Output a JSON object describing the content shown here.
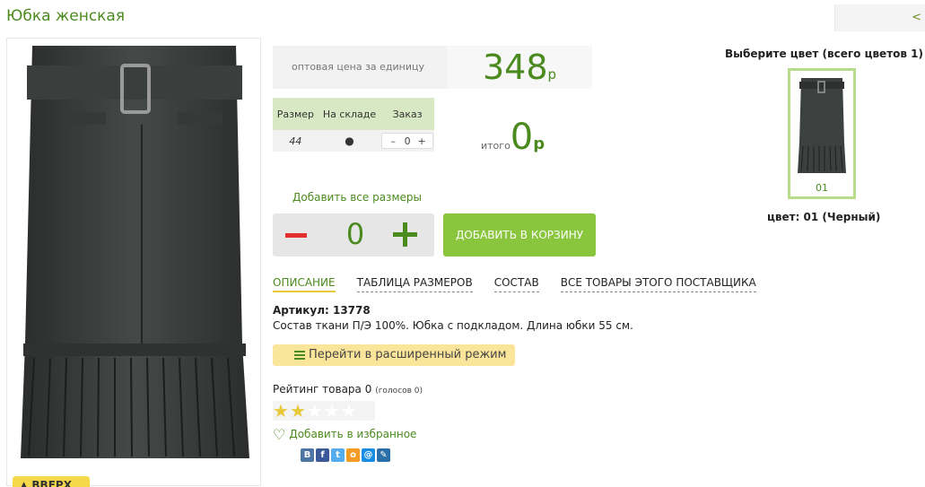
{
  "page": {
    "title": "Юбка женская",
    "nav_prev": "<"
  },
  "badge": {
    "text": "▲ ВВЕРХ"
  },
  "price": {
    "label": "оптовая цена за единицу",
    "value": "348",
    "currency": "р"
  },
  "size_table": {
    "headers": [
      "Размер",
      "На складе",
      "Заказ"
    ],
    "rows": [
      {
        "size": "44",
        "stock": "●",
        "order": {
          "minus": "–",
          "value": "0",
          "plus": "+"
        }
      }
    ]
  },
  "total": {
    "label": "итого",
    "value": "0",
    "currency": "р"
  },
  "add_all_sizes": "Добавить все размеры",
  "quantity": {
    "value": "0"
  },
  "cart_button": "ДОБАВИТЬ В КОРЗИНУ",
  "tabs": [
    {
      "label": "ОПИСАНИЕ",
      "active": true
    },
    {
      "label": "ТАБЛИЦА РАЗМЕРОВ",
      "active": false
    },
    {
      "label": "СОСТАВ",
      "active": false
    },
    {
      "label": "ВСЕ ТОВАРЫ ЭТОГО ПОСТАВЩИКА",
      "active": false
    }
  ],
  "article": "Артикул: 13778",
  "description": "Состав ткани П/Э 100%. Юбка с подкладом. Длина юбки 55 см.",
  "extended_mode": "Перейти в расширенный режим",
  "rating": {
    "text": "Рейтинг товара 0",
    "votes": "(голосов 0)",
    "stars_filled": 2,
    "stars_total": 5
  },
  "favorite": "Добавить в избранное",
  "social": [
    {
      "icon": "vk-icon",
      "text": "В",
      "color": "#4c75a3"
    },
    {
      "icon": "facebook-icon",
      "text": "f",
      "color": "#3b5998"
    },
    {
      "icon": "twitter-icon",
      "text": "t",
      "color": "#55acee"
    },
    {
      "icon": "odnoklassniki-icon",
      "text": "о",
      "color": "#f59a23"
    },
    {
      "icon": "mailru-icon",
      "text": "@",
      "color": "#168de2"
    },
    {
      "icon": "livejournal-icon",
      "text": "✎",
      "color": "#2b6fa8"
    }
  ],
  "colors": {
    "title": "Выберите цвет (всего цветов 1)",
    "items": [
      {
        "code": "01"
      }
    ],
    "selected_label": "цвет: 01 (Черный)"
  },
  "theme": {
    "accent": "#4b8a1e",
    "button": "#8ac53e",
    "minus": "#e53030",
    "highlight": "#fbe59a"
  }
}
